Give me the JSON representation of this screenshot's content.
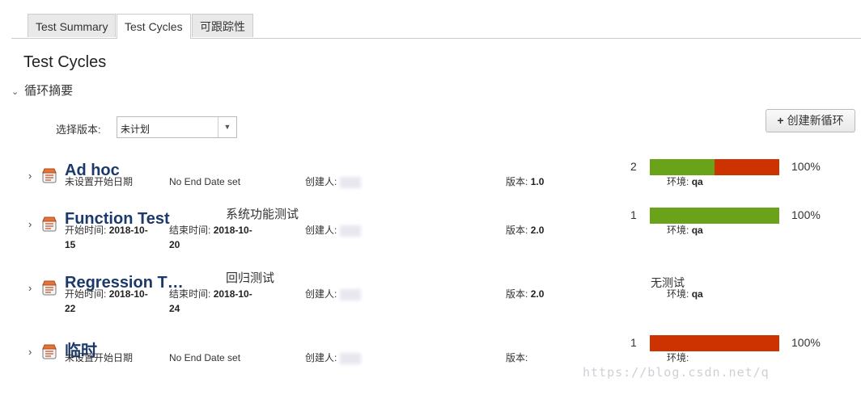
{
  "tabs": [
    {
      "label": "Test Summary"
    },
    {
      "label": "Test Cycles"
    },
    {
      "label": "可跟踪性"
    }
  ],
  "page_title": "Test Cycles",
  "summary_toggle": "循环摘要",
  "version_select": {
    "label": "选择版本:",
    "value": "未计划"
  },
  "create_button": "创建新循环",
  "cycles": [
    {
      "name": "Ad hoc",
      "desc": "",
      "start_label": "未设置开始日期",
      "start_value": "",
      "start_value2": "",
      "end_label": "No End Date set",
      "end_value": "",
      "end_value2": "",
      "creator_label": "创建人:",
      "version_label": "版本:",
      "version_value": "1.0",
      "count": "2",
      "percent": "100%",
      "status_text": "",
      "env_label": "环境:",
      "env_value": "qa",
      "pass_fraction": 0.5,
      "fail_fraction": 0.5
    },
    {
      "name": "Function Test",
      "desc": "系统功能测试",
      "start_label": "开始时间:",
      "start_value": "2018-10-",
      "start_value2": "15",
      "end_label": "结束时间:",
      "end_value": "2018-10-",
      "end_value2": "20",
      "creator_label": "创建人:",
      "version_label": "版本:",
      "version_value": "2.0",
      "count": "1",
      "percent": "100%",
      "status_text": "",
      "env_label": "环境:",
      "env_value": "qa",
      "pass_fraction": 1.0,
      "fail_fraction": 0.0
    },
    {
      "name": "Regression T…",
      "desc": "回归测试",
      "start_label": "开始时间:",
      "start_value": "2018-10-",
      "start_value2": "22",
      "end_label": "结束时间:",
      "end_value": "2018-10-",
      "end_value2": "24",
      "creator_label": "创建人:",
      "version_label": "版本:",
      "version_value": "2.0",
      "count": "",
      "percent": "",
      "status_text": "无测试",
      "env_label": "环境:",
      "env_value": "qa",
      "pass_fraction": 0.0,
      "fail_fraction": 0.0
    },
    {
      "name": "临时",
      "desc": "",
      "start_label": "未设置开始日期",
      "start_value": "",
      "start_value2": "",
      "end_label": "No End Date set",
      "end_value": "",
      "end_value2": "",
      "creator_label": "创建人:",
      "version_label": "版本:",
      "version_value": "",
      "count": "1",
      "percent": "100%",
      "status_text": "",
      "env_label": "环境:",
      "env_value": "",
      "pass_fraction": 0.0,
      "fail_fraction": 1.0
    }
  ],
  "colors": {
    "pass": "#6aa31a",
    "fail": "#cc3300",
    "link": "#1b3a6b"
  },
  "watermark": "https://blog.csdn.net/q"
}
